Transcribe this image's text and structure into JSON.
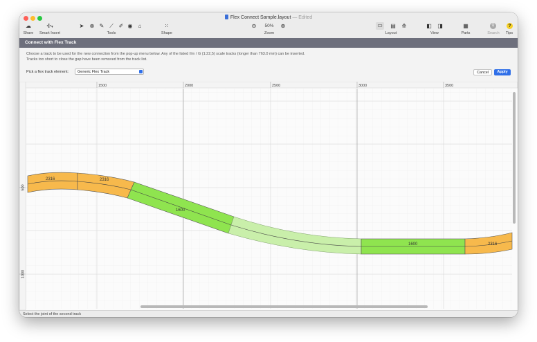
{
  "window": {
    "title": "Flex Connect Sample.layout",
    "title_sep": " — ",
    "edited": "Edited"
  },
  "toolbar": {
    "share": "Share",
    "smart_insert": "Smart Insert",
    "tools": "Tools",
    "shape": "Shape",
    "zoom_value": "50%",
    "zoom": "Zoom",
    "layout": "Layout",
    "view": "View",
    "parts": "Parts",
    "search": "Search",
    "tips": "Tips"
  },
  "panel": {
    "title": "Connect with Flex Track",
    "info_line1": "Choose a track to be used for the new connection from the pop-up menu below. Any of the listed IIm / G (1:22,5) scale tracks (longer than 763.0 mm) can be inserted.",
    "info_line2": "Tracks too short to close the gap have been removed from the track list.",
    "pick_label": "Pick a flex track element:",
    "pick_value": "Generic Flex Track",
    "cancel": "Cancel",
    "apply": "Apply"
  },
  "ruler": {
    "x_labels": [
      "1500",
      "2000",
      "2500",
      "3000",
      "3500"
    ],
    "y_labels": [
      "500",
      "1000"
    ]
  },
  "tracks": {
    "labels": [
      "2316",
      "2316",
      "1600",
      "1600",
      "2316"
    ]
  },
  "colors": {
    "orange_track": "#f7b94c",
    "green_track": "#8fe44f",
    "flex_preview": "#c9efaa",
    "panel_bar": "#6d6f7c",
    "accent": "#2f6fe8"
  },
  "status": {
    "text": "Select the joint of the second track"
  }
}
